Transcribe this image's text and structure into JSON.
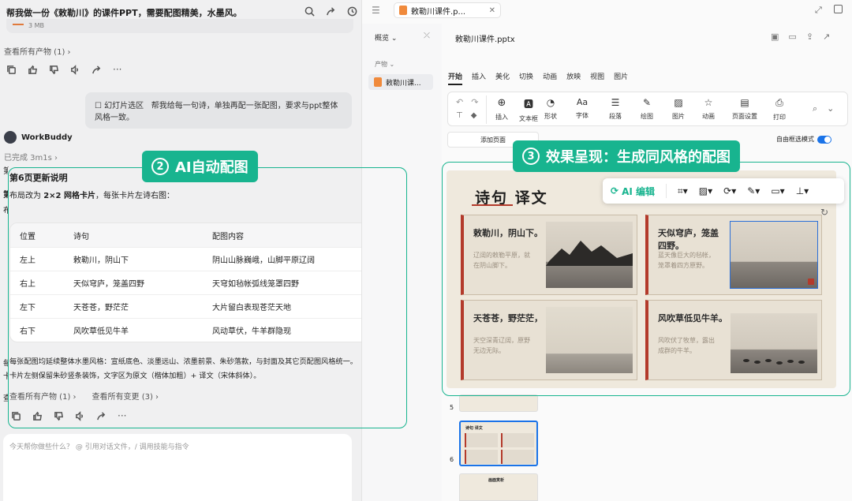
{
  "chat": {
    "title": "帮我做一份《敕勒川》的课件PPT，需要配图精美，水墨风。",
    "file_size": "3 MB",
    "view_all_products": "查看所有产物 (1)",
    "user_msg_tag": "幻灯片选区",
    "user_msg": "帮我给每一句诗，单独再配一张配图，要求与ppt整体风格一致。",
    "bot_name": "WorkBuddy",
    "bot_status": "已完成 3m1s",
    "section_title": "第6页更新说明",
    "intro_prefix": "布局改为 ",
    "intro_bold": "2×2 网格卡片",
    "intro_suffix": "，每张卡片左诗右图：",
    "table": {
      "headers": [
        "位置",
        "诗句",
        "配图内容"
      ],
      "rows": [
        [
          "左上",
          "敕勒川，阴山下",
          "阴山山脉巍峨，山脚平原辽阔"
        ],
        [
          "右上",
          "天似穹庐，笼盖四野",
          "天穹如毡帐弧线笼罩四野"
        ],
        [
          "左下",
          "天苍苍，野茫茫",
          "大片留白表现苍茫天地"
        ],
        [
          "右下",
          "风吹草低见牛羊",
          "风动草伏，牛羊群隐现"
        ]
      ]
    },
    "summary_1": "每张配图均延续整体水墨风格：宣纸底色、淡墨远山、浓墨前景、朱砂落款，与封面及其它页配图风格统一。",
    "summary_2": "卡片左侧保留朱砂竖条装饰，文字区为原文（楷体加粗）+ 译文（宋体斜体）。",
    "view_all_changes": "查看所有变更 (3)",
    "input_placeholder": "今天帮你做些什么？ @ 引用对话文件，/ 调用技能与指令",
    "side_letters": [
      "第",
      "第",
      "布",
      "每",
      "卡",
      "查"
    ]
  },
  "banners": {
    "ai_draw": "AI自动配图",
    "ai_draw_num": "2",
    "result": "效果呈现：生成同风格的配图",
    "result_num": "3"
  },
  "editor": {
    "tab_title": "敕勒川课件.p...",
    "overview": "概览",
    "products": "产物",
    "product_item": "敕勒川课...",
    "file_title": "敕勒川课件.pptx",
    "menu": [
      "开始",
      "插入",
      "美化",
      "切换",
      "动画",
      "放映",
      "视图",
      "图片"
    ],
    "tools": [
      "插入",
      "文本框",
      "形状",
      "字体",
      "段落",
      "绘图",
      "图片",
      "动画",
      "页面设置",
      "打印"
    ],
    "add_page": "添加页面",
    "free_select": "自由框选模式",
    "slide_title": "诗句 译文",
    "cards": [
      {
        "poem": "敕勒川，阴山下。",
        "trans": [
          "辽阔的敕勒平原，就",
          "在阴山脚下。"
        ]
      },
      {
        "poem": "天似穹庐，笼盖",
        "poem2": "四野。",
        "trans": [
          "蓝天像巨大的毡帐，",
          "笼罩着四方原野。"
        ]
      },
      {
        "poem": "天苍苍，野茫茫，",
        "trans": [
          "天空深青辽阔，原野",
          "无边无际。"
        ]
      },
      {
        "poem": "风吹草低见牛羊。",
        "trans": [
          "风吹伏了牧草，露出",
          "成群的牛羊。"
        ]
      }
    ],
    "ai_edit": "AI 编辑",
    "thumb_nums": [
      "5",
      "6"
    ],
    "thumb_labels": [
      "诗句 译文",
      "画面赏析"
    ]
  },
  "colors": {
    "accent": "#18b48f",
    "toggle": "#1a73e8",
    "seal": "#b33a2b"
  }
}
